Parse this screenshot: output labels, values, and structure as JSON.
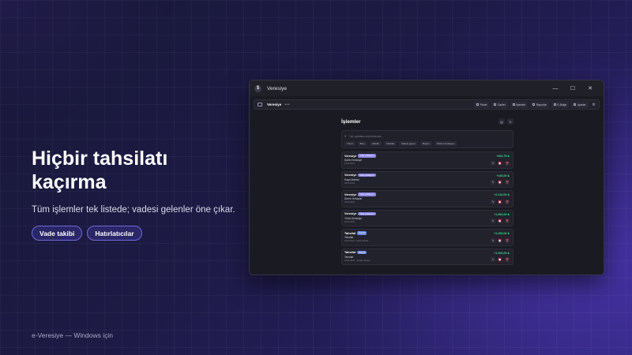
{
  "hero": {
    "title_line1": "Hiçbir tahsilatı",
    "title_line2": "kaçırma",
    "subtitle": "Tüm işlemler tek listede; vadesi gelenler öne çıkar.",
    "buttons": [
      {
        "label": "Vade takibi"
      },
      {
        "label": "Hatırlatıcılar"
      }
    ]
  },
  "footer": {
    "text": "e-Veresiye — Windows için"
  },
  "window": {
    "title": "Veresiye",
    "app_icon_glyph": "$",
    "controls": {
      "minimize": "—",
      "maximize": "☐",
      "close": "✕"
    }
  },
  "toolbar": {
    "brand": "Veresiye",
    "dots": "•••",
    "nav": [
      {
        "label": "Panel",
        "icon": "grid-icon"
      },
      {
        "label": "Cariler",
        "icon": "users-icon"
      },
      {
        "label": "İşlemler",
        "icon": "list-icon"
      },
      {
        "label": "Raporlar",
        "icon": "chart-icon"
      },
      {
        "label": "E-Belge",
        "icon": "doc-icon"
      },
      {
        "label": "Ayarlar",
        "icon": "settings-icon"
      }
    ]
  },
  "main": {
    "title": "İşlemler",
    "search_placeholder": "Cari, açıklama veya tutar ara...",
    "filters": [
      "Tümü",
      "Borç",
      "Alacak",
      "Tahsilat",
      "Vadesi geçen",
      "Bugün",
      "Ödeme bekleyen"
    ],
    "transactions": [
      {
        "type": "Veresiye",
        "badge": "Vade yaklaşıyor",
        "name": "Şahin Kırtasiye",
        "meta": "12.05.2024",
        "amount": "+920,75 ₺",
        "badge_kind": "due"
      },
      {
        "type": "Veresiye",
        "badge": "Vade yaklaşıyor",
        "name": "Kaya Market",
        "meta": "08.05.2024",
        "amount": "+445,00 ₺",
        "badge_kind": "due"
      },
      {
        "type": "Veresiye",
        "badge": "Vade yaklaşıyor",
        "name": "Demir Hırdavat",
        "meta": "03.05.2024",
        "amount": "+2.140,00 ₺",
        "badge_kind": "due"
      },
      {
        "type": "Veresiye",
        "badge": "Vade yaklaşıyor",
        "name": "Yıldız Kırtasiye",
        "meta": "29.04.2024",
        "amount": "+1.800,00 ₺",
        "badge_kind": "due"
      },
      {
        "type": "Tahsilat",
        "badge": "Ödendi",
        "name": "Tahsilat",
        "meta": "24.04.2024 · Nakit tahsilat",
        "amount": "+2.450,00 ₺",
        "badge_kind": "paid"
      },
      {
        "type": "Tahsilat",
        "badge": "Ödendi",
        "name": "Tahsilat",
        "meta": "18.04.2024 · Havale tahsilat",
        "amount": "+1.000,00 ₺",
        "badge_kind": "paid"
      }
    ]
  },
  "colors": {
    "accent": "#6f6ad8",
    "amount_positive": "#3ed68a",
    "delete": "#e05a5a",
    "window_bg": "#1a1a22"
  }
}
